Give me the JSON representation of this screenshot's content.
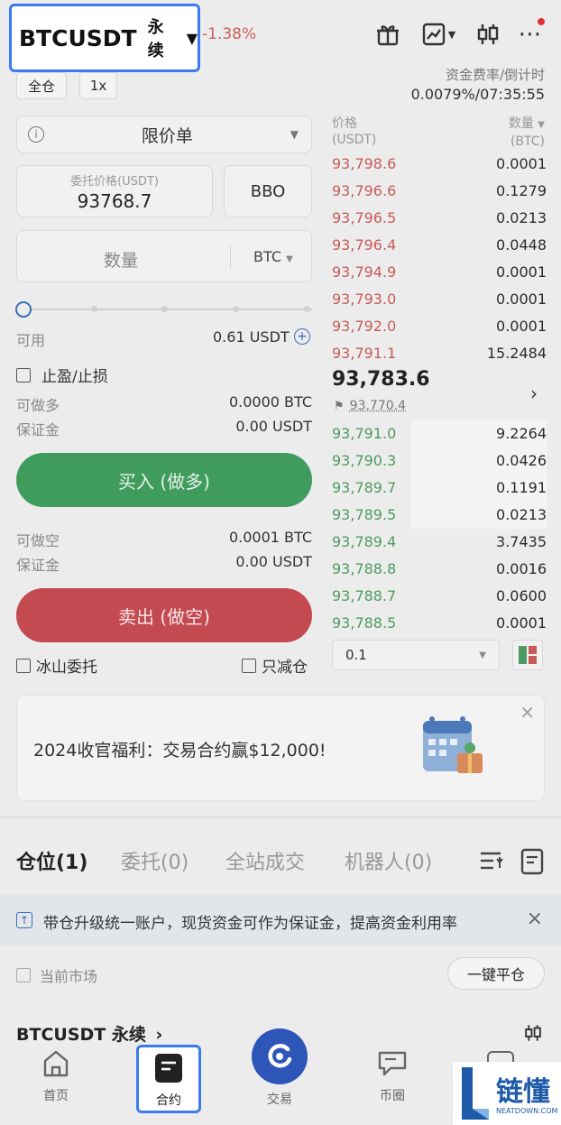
{
  "header": {
    "symbol": "BTCUSDT",
    "contract_type": "永续",
    "change": "-1.38%",
    "funding_label": "资金费率/倒计时",
    "funding_value": "0.0079%/07:35:55"
  },
  "order_form": {
    "margin_mode": "全仓",
    "leverage": "1x",
    "order_type": "限价单",
    "price_label": "委托价格(USDT)",
    "price_value": "93768.7",
    "bbo": "BBO",
    "quantity_placeholder": "数量",
    "quantity_unit": "BTC",
    "available_label": "可用",
    "available_value": "0.61 USDT",
    "tpsl_label": "止盈/止损",
    "long_label": "可做多",
    "long_value": "0.0000 BTC",
    "margin_label": "保证金",
    "long_margin_value": "0.00 USDT",
    "buy_button": "买入 (做多)",
    "short_label": "可做空",
    "short_value": "0.0001 BTC",
    "short_margin_value": "0.00 USDT",
    "sell_button": "卖出 (做空)",
    "iceberg_label": "冰山委托",
    "reduce_only_label": "只减仓"
  },
  "orderbook": {
    "price_header": "价格",
    "price_unit": "(USDT)",
    "qty_header": "数量",
    "qty_unit": "(BTC)",
    "asks": [
      {
        "price": "93,798.6",
        "qty": "0.0001"
      },
      {
        "price": "93,796.6",
        "qty": "0.1279"
      },
      {
        "price": "93,796.5",
        "qty": "0.0213"
      },
      {
        "price": "93,796.4",
        "qty": "0.0448"
      },
      {
        "price": "93,794.9",
        "qty": "0.0001"
      },
      {
        "price": "93,793.0",
        "qty": "0.0001"
      },
      {
        "price": "93,792.0",
        "qty": "0.0001"
      },
      {
        "price": "93,791.1",
        "qty": "15.2484"
      }
    ],
    "last_price": "93,783.6",
    "mark_price": "93,770.4",
    "bids": [
      {
        "price": "93,791.0",
        "qty": "9.2264"
      },
      {
        "price": "93,790.3",
        "qty": "0.0426"
      },
      {
        "price": "93,789.7",
        "qty": "0.1191"
      },
      {
        "price": "93,789.5",
        "qty": "0.0213"
      },
      {
        "price": "93,789.4",
        "qty": "3.7435"
      },
      {
        "price": "93,788.8",
        "qty": "0.0016"
      },
      {
        "price": "93,788.7",
        "qty": "0.0600"
      },
      {
        "price": "93,788.5",
        "qty": "0.0001"
      }
    ],
    "depth_step": "0.1"
  },
  "promo": {
    "text": "2024收官福利：交易合约赢$12,000!"
  },
  "tabs": {
    "positions": "仓位(1)",
    "orders": "委托(0)",
    "trades": "全站成交",
    "bots": "机器人(0)"
  },
  "notice": {
    "text": "带仓升级统一账户，现货资金可作为保证金，提高资金利用率"
  },
  "positions": {
    "current_market": "当前市场",
    "close_all": "一键平仓",
    "row_symbol": "BTCUSDT 永续"
  },
  "nav": {
    "home": "首页",
    "contract": "合约",
    "trade": "交易",
    "feed": "币圈"
  },
  "watermark": {
    "name": "链懂",
    "site": "NEATDOWN.COM"
  }
}
